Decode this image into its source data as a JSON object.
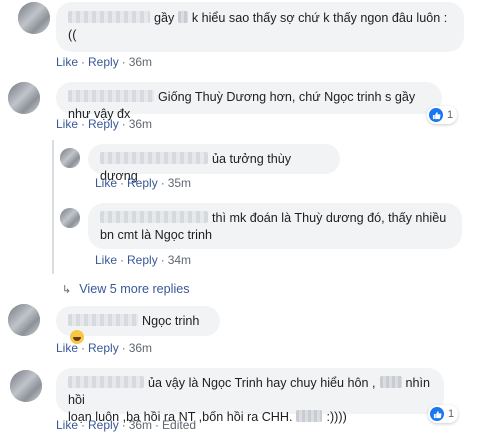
{
  "comments": [
    {
      "text": "gầy    k hiểu sao thấy sợ chứ k thấy ngon đâu luôn : ((",
      "line1": "gầy",
      "line1b": "k hiểu sao thấy sợ chứ k thấy ngon đâu luôn :",
      "line2": "((",
      "like": "Like",
      "reply": "Reply",
      "time": "36m"
    },
    {
      "text": "Giống Thuỳ Dương hơn, chứ Ngọc trinh s gầy như vậy đx",
      "like": "Like",
      "reply": "Reply",
      "time": "36m",
      "reaction_count": "1"
    },
    {
      "text": "ủa tưởng thùy dương",
      "like": "Like",
      "reply": "Reply",
      "time": "35m"
    },
    {
      "line1": "thì mk đoán là Thuỳ dương đó, thấy nhiều",
      "line2": "bn cmt là Ngọc trinh",
      "like": "Like",
      "reply": "Reply",
      "time": "34m"
    },
    {
      "text": "Ngọc trinh",
      "like": "Like",
      "reply": "Reply",
      "time": "36m"
    },
    {
      "line1": "ủa vậy là Ngọc Trinh hay chuy hiểu hôn ,",
      "line1b": "nhìn hồi",
      "line2": "loạn luôn ,ba hồi ra NT ,bốn hồi ra CHH.",
      "line2b": ":))))",
      "like": "Like",
      "reply": "Reply",
      "time": "36m",
      "edited": "Edited",
      "reaction_count": "1"
    }
  ],
  "view_more": "View 5 more replies",
  "separator": "·",
  "icons": {
    "like_reaction": "thumbs-up-icon",
    "view_more": "reply-arrow-icon",
    "emoji": "laughing-emoji-icon"
  },
  "colors": {
    "link": "#385898",
    "bubble": "#f2f3f5",
    "like_blue": "#1877f2",
    "meta": "#606770"
  }
}
